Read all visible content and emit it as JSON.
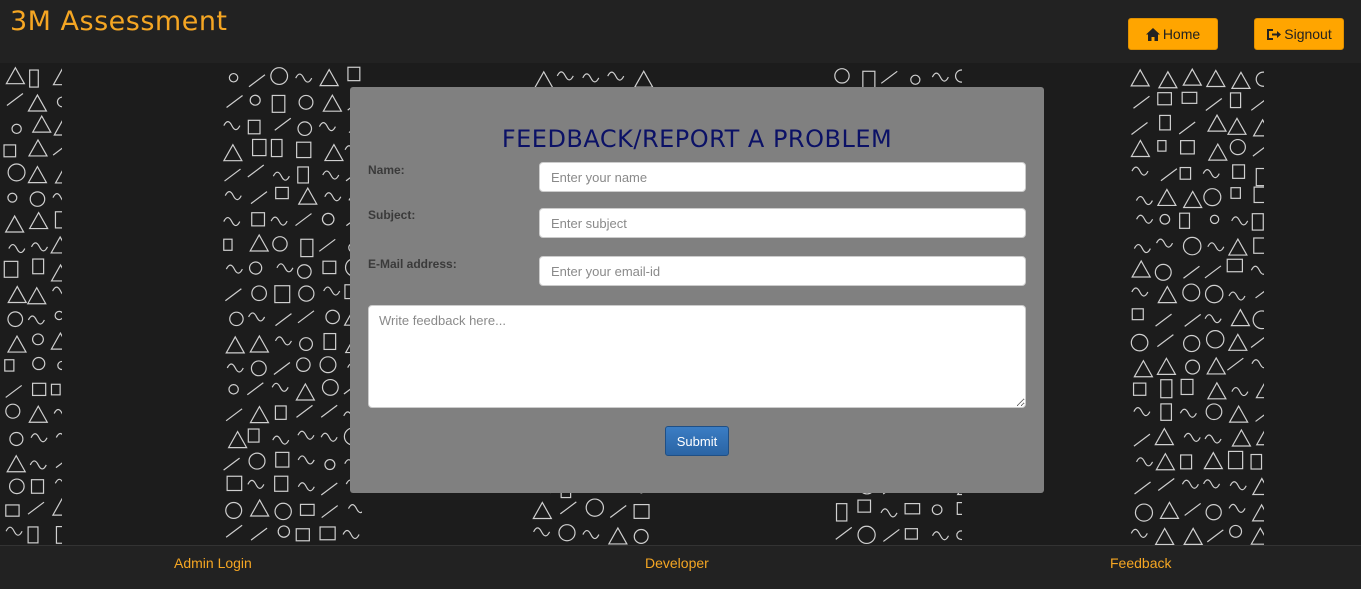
{
  "header": {
    "brand": "3M Assessment",
    "home_label": "Home",
    "signout_label": "Signout",
    "accent_color": "#ffa500"
  },
  "form": {
    "title": "FEEDBACK/REPORT A PROBLEM",
    "name_label": "Name:",
    "name_placeholder": "Enter your name",
    "subject_label": "Subject:",
    "subject_placeholder": "Enter subject",
    "email_label": "E-Mail address:",
    "email_placeholder": "Enter your email-id",
    "feedback_placeholder": "Write feedback here...",
    "submit_label": "Submit"
  },
  "footer": {
    "links": [
      "Admin Login",
      "Developer",
      "Feedback"
    ]
  },
  "icons": {
    "home": "home-icon",
    "signout": "signout-icon"
  }
}
